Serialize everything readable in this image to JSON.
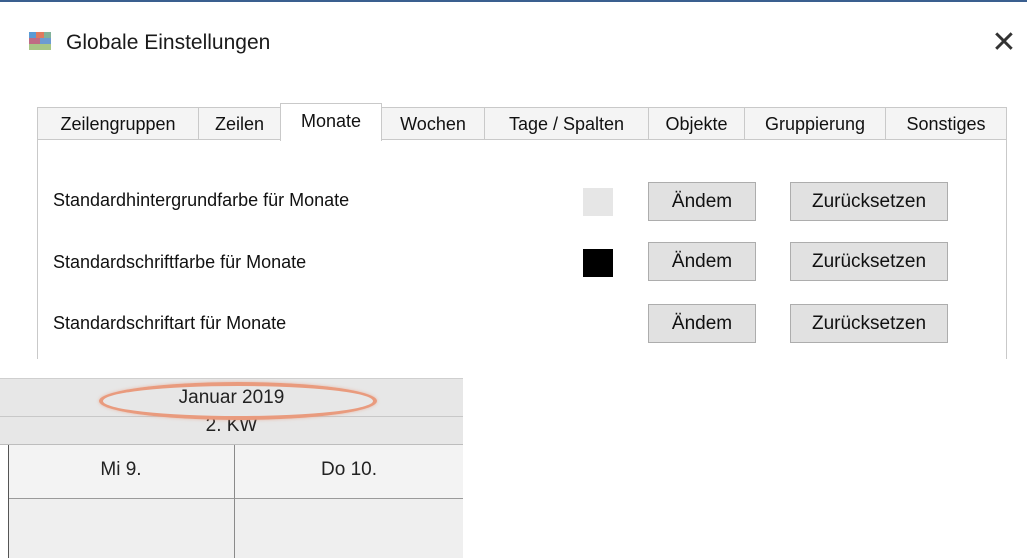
{
  "dialog": {
    "title": "Globale Einstellungen",
    "close_glyph": "✕",
    "tabs": [
      {
        "label": "Zeilengruppen"
      },
      {
        "label": "Zeilen"
      },
      {
        "label": "Monate",
        "selected": true
      },
      {
        "label": "Wochen"
      },
      {
        "label": "Tage / Spalten"
      },
      {
        "label": "Objekte"
      },
      {
        "label": "Gruppierung"
      },
      {
        "label": "Sonstiges"
      }
    ],
    "settings": [
      {
        "label": "Standardhintergrundfarbe für Monate",
        "swatch_color": "#e6e6e6",
        "change_label": "Ändem",
        "reset_label": "Zurücksetzen"
      },
      {
        "label": "Standardschriftfarbe für Monate",
        "swatch_color": "#000000",
        "change_label": "Ändem",
        "reset_label": "Zurücksetzen"
      },
      {
        "label": "Standardschriftart für Monate",
        "change_label": "Ändem",
        "reset_label": "Zurücksetzen"
      }
    ]
  },
  "calendar": {
    "month_label": "Januar 2019",
    "week_label": "2. KW",
    "days": [
      {
        "label": "Mi 9."
      },
      {
        "label": "Do 10."
      }
    ],
    "highlight_color": "#e99b7e"
  },
  "icons": {
    "app": "app-icon",
    "close": "close-icon"
  }
}
